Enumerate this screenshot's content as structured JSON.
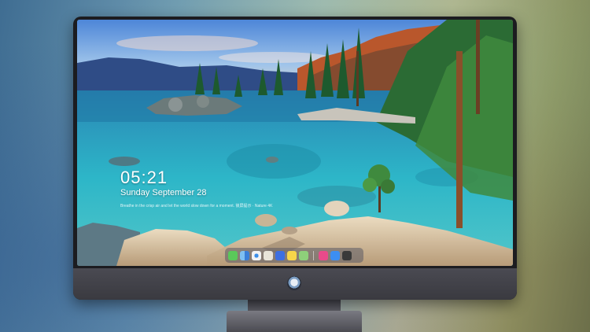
{
  "lock_screen": {
    "time": "05:21",
    "date": "Sunday September  28",
    "tip": "Breathe in the crisp air and let the world slow down for a moment. 锁屏提示 · Nature 4K"
  },
  "dock": {
    "icons": [
      {
        "name": "messages-icon",
        "color": "#5ac85a"
      },
      {
        "name": "finder-icon",
        "color": "#4a9ae8"
      },
      {
        "name": "safari-icon",
        "color": "#f2f2f2"
      },
      {
        "name": "photos-icon",
        "color": "#e8e4d8"
      },
      {
        "name": "mail-icon",
        "color": "#3d6fe0"
      },
      {
        "name": "notes-icon",
        "color": "#f7d54a"
      },
      {
        "name": "maps-icon",
        "color": "#8ed07a"
      },
      {
        "name": "music-icon",
        "color": "#e84a8a"
      },
      {
        "name": "appstore-icon",
        "color": "#3c8ef2"
      },
      {
        "name": "camera-icon",
        "color": "#3a3a3a"
      }
    ]
  },
  "colors": {
    "water": "#2fb3c9",
    "sky": "#6a9ce0",
    "rocks": "#d8c6a8",
    "bezel": "#1c1c20"
  }
}
